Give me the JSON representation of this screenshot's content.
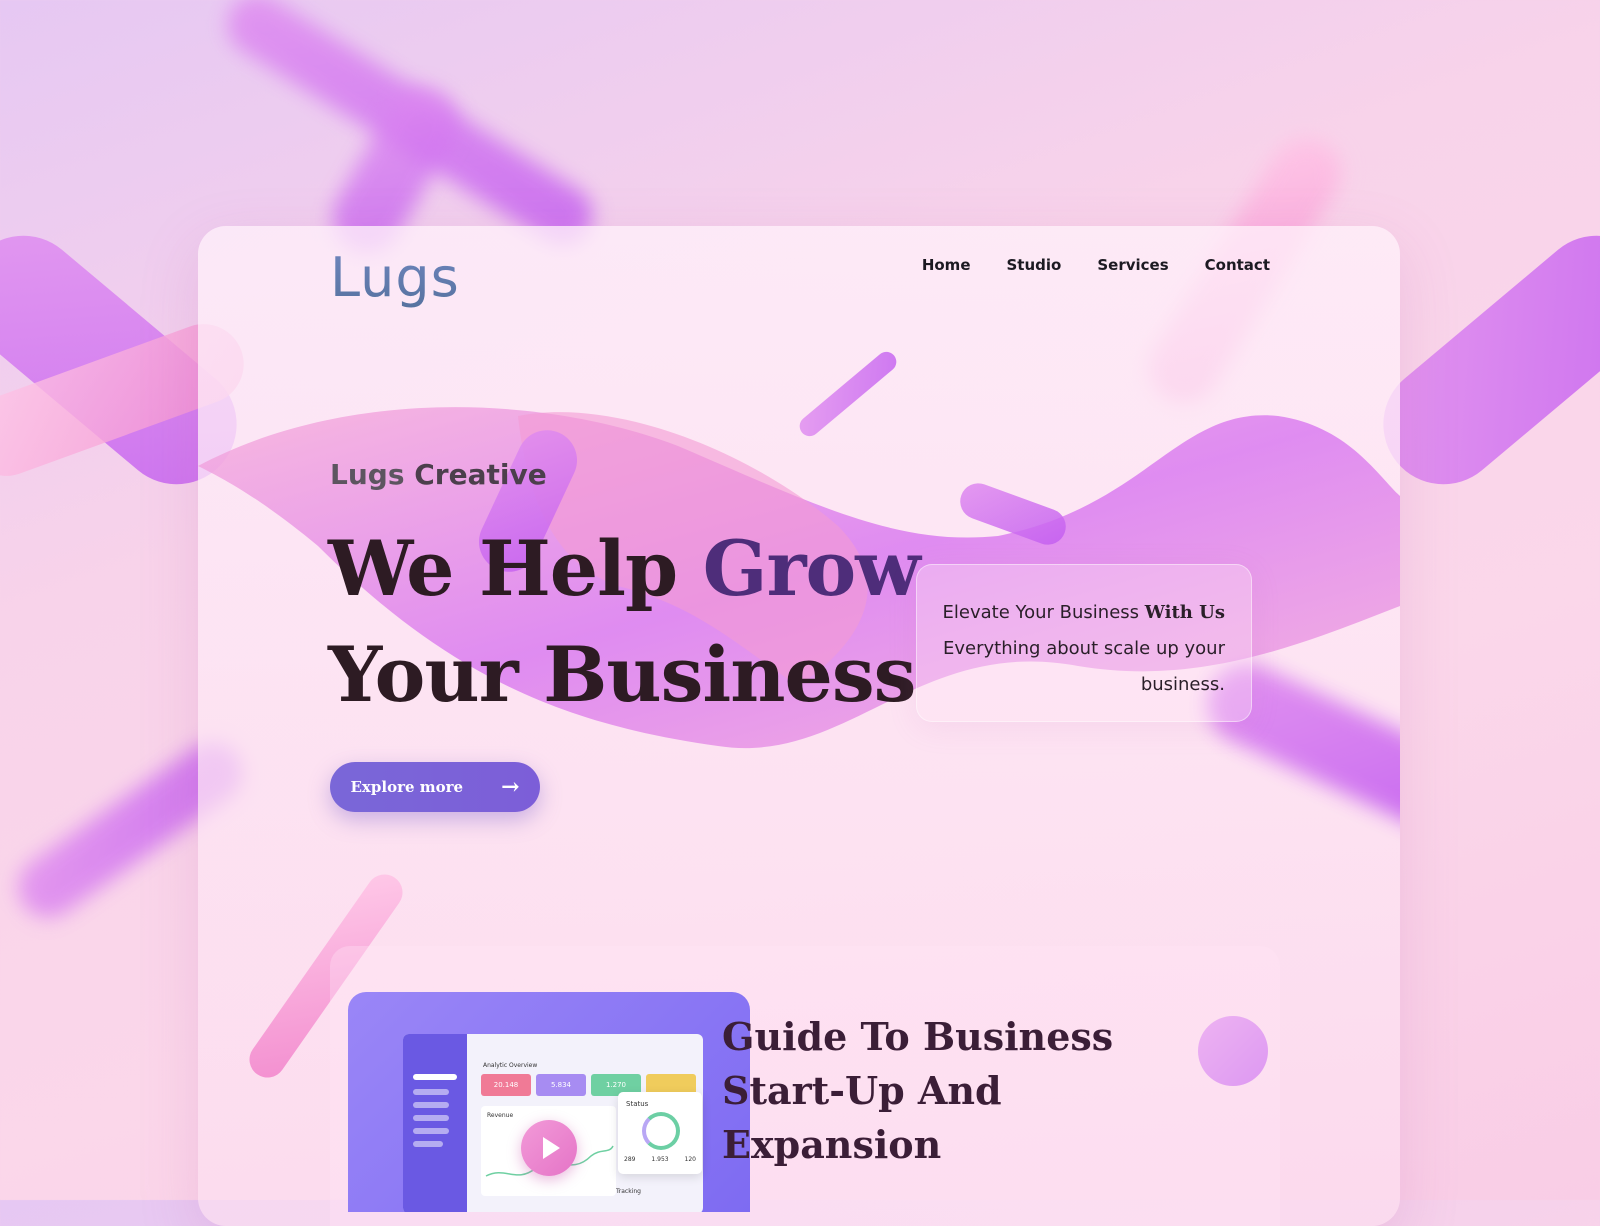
{
  "brand": {
    "logo": "Lugs"
  },
  "nav": {
    "items": [
      "Home",
      "Studio",
      "Services",
      "Contact"
    ]
  },
  "hero": {
    "eyebrow_light": "Lugs",
    "eyebrow_bold": "Creative",
    "headline_1a": "We Help ",
    "headline_1b": "Grow",
    "headline_2": "Your Business",
    "cta_label": "Explore more",
    "cta_icon": "arrow-right-icon"
  },
  "info": {
    "line1_a": "Elevate Your Business ",
    "line1_b": "With Us",
    "line2": "Everything about scale up your",
    "line3": "business."
  },
  "dashboard": {
    "title": "Analytic Overview",
    "stats": [
      "20.148",
      "5.834",
      "1.270"
    ],
    "revenue_label": "Revenue",
    "status_label": "Status",
    "status_numbers": [
      "289",
      "1.953",
      "120"
    ],
    "tracking_label": "Tracking"
  },
  "section2": {
    "title_line1": "Guide To Business",
    "title_line2": "Start-Up And",
    "title_line3": "Expansion"
  },
  "colors": {
    "accent": "#7a67d8",
    "heading": "#2d1b23",
    "accent_word": "#4e2d7a",
    "background_pink": "#fbd7ea",
    "background_lavender": "#e6c8f3"
  }
}
